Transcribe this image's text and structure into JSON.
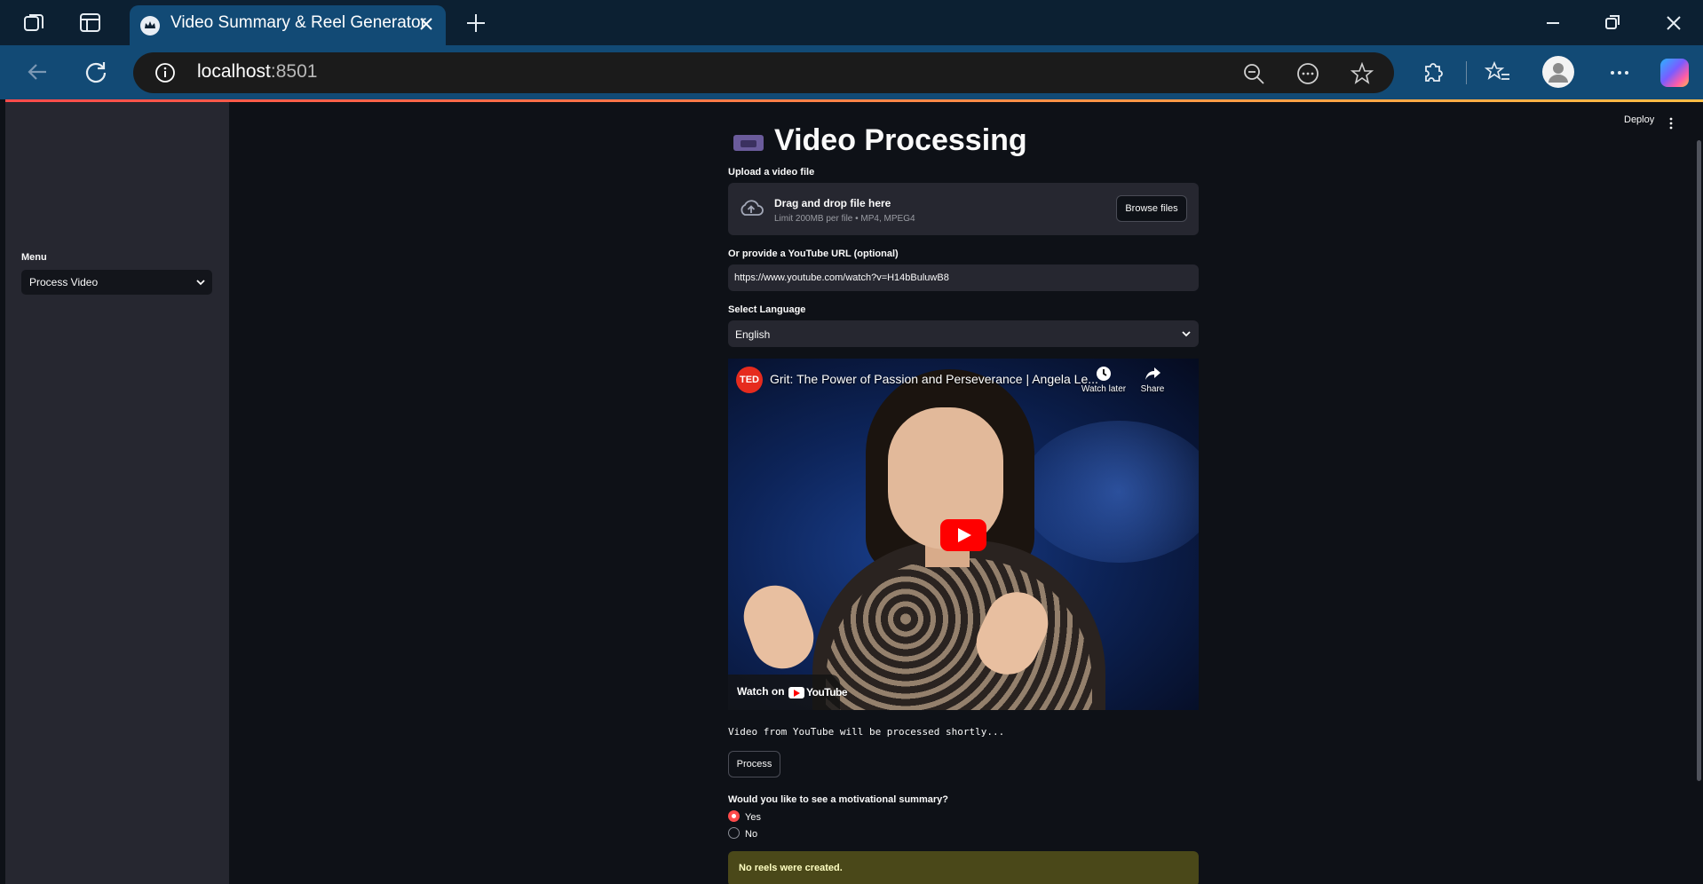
{
  "browser": {
    "tab_title": "Video Summary & Reel Generator",
    "url_host": "localhost",
    "url_port": ":8501"
  },
  "app": {
    "deploy_label": "Deploy",
    "sidebar": {
      "menu_label": "Menu",
      "menu_value": "Process Video"
    },
    "page_title": "Video Processing",
    "upload": {
      "label": "Upload a video file",
      "drag_text": "Drag and drop file here",
      "limit_text": "Limit 200MB per file • MP4, MPEG4",
      "browse_label": "Browse files"
    },
    "youtube": {
      "label": "Or provide a YouTube URL (optional)",
      "value": "https://www.youtube.com/watch?v=H14bBuluwB8"
    },
    "language": {
      "label": "Select Language",
      "value": "English"
    },
    "video": {
      "channel_badge": "TED",
      "title": "Grit: The Power of Passion and Perseverance | Angela Le...",
      "watch_later": "Watch later",
      "share": "Share",
      "watch_on": "Watch on",
      "youtube_word": "YouTube"
    },
    "status_text": "Video from YouTube will be processed shortly...",
    "process_label": "Process",
    "question": "Would you like to see a motivational summary?",
    "options": [
      {
        "label": "Yes",
        "selected": true
      },
      {
        "label": "No",
        "selected": false
      }
    ],
    "warning": "No reels were created.",
    "colors": {
      "primary": "#ff4b4b",
      "background": "#0e1117",
      "sidebar": "#262730",
      "warning_bg": "#4a4819",
      "browser_frame": "#124a75"
    }
  }
}
